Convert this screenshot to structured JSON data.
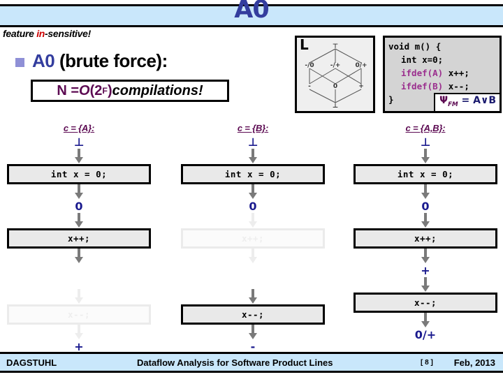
{
  "header": {
    "title": "A0",
    "subtitle_prefix": "feature ",
    "subtitle_highlight": "in",
    "subtitle_suffix": "-sensitive!"
  },
  "bullet": {
    "icon": "square-bullet-icon",
    "label_blue": "A0",
    "label_black": " (brute force):"
  },
  "formula": {
    "lhs": "N = ",
    "big_o": "O",
    "paren_open": "(2",
    "exponent": "F",
    "paren_close": ")",
    "rhs": " compilations!"
  },
  "lattice": {
    "panel_label": "L",
    "nodes": {
      "top": "⊤",
      "bottom": "⊥",
      "left_upper": "-/0",
      "mid_upper": "-/+",
      "right_upper": "0/+",
      "left_lower": "-",
      "mid_lower": "0",
      "right_lower": "+"
    }
  },
  "code": {
    "lines": [
      {
        "indent": 0,
        "parts": [
          {
            "t": "void m() {",
            "k": false
          }
        ]
      },
      {
        "indent": 1,
        "parts": [
          {
            "t": "int x=0;",
            "k": false
          }
        ]
      },
      {
        "indent": 1,
        "parts": [
          {
            "t": "ifdef(A)",
            "k": true
          },
          {
            "t": " x++;",
            "k": false
          }
        ]
      },
      {
        "indent": 1,
        "parts": [
          {
            "t": "ifdef(B)",
            "k": true
          },
          {
            "t": " x--;",
            "k": false
          }
        ]
      },
      {
        "indent": 0,
        "parts": [
          {
            "t": "}",
            "k": false
          }
        ]
      }
    ],
    "fm_badge": {
      "psi": "Ψ",
      "subscript": "FM",
      "equals": " = ",
      "expr": "A∨B"
    }
  },
  "columns": [
    {
      "header": "c = {A}:",
      "steps": [
        {
          "kind": "value",
          "text": "⊥",
          "faded": false
        },
        {
          "kind": "arrow",
          "faded": false
        },
        {
          "kind": "box",
          "text": "int x = 0;",
          "faded": false
        },
        {
          "kind": "arrow",
          "faded": false
        },
        {
          "kind": "value",
          "text": "0",
          "faded": false
        },
        {
          "kind": "arrow",
          "faded": false
        },
        {
          "kind": "box",
          "text": "x++;",
          "faded": false
        },
        {
          "kind": "arrow",
          "faded": false
        },
        {
          "kind": "spacer"
        },
        {
          "kind": "arrow",
          "faded": true
        },
        {
          "kind": "box",
          "text": "x--;",
          "faded": true
        },
        {
          "kind": "arrow",
          "faded": true
        },
        {
          "kind": "value",
          "text": "+",
          "faded": false
        }
      ]
    },
    {
      "header": "c = {B}:",
      "steps": [
        {
          "kind": "value",
          "text": "⊥",
          "faded": false
        },
        {
          "kind": "arrow",
          "faded": false
        },
        {
          "kind": "box",
          "text": "int x = 0;",
          "faded": false
        },
        {
          "kind": "arrow",
          "faded": false
        },
        {
          "kind": "value",
          "text": "0",
          "faded": false
        },
        {
          "kind": "arrow",
          "faded": true
        },
        {
          "kind": "box",
          "text": "x++;",
          "faded": true
        },
        {
          "kind": "arrow",
          "faded": true
        },
        {
          "kind": "spacer"
        },
        {
          "kind": "arrow",
          "faded": false
        },
        {
          "kind": "box",
          "text": "x--;",
          "faded": false
        },
        {
          "kind": "arrow",
          "faded": false
        },
        {
          "kind": "value",
          "text": "-",
          "faded": false
        }
      ]
    },
    {
      "header": "c = {A,B}:",
      "steps": [
        {
          "kind": "value",
          "text": "⊥",
          "faded": false
        },
        {
          "kind": "arrow",
          "faded": false
        },
        {
          "kind": "box",
          "text": "int x = 0;",
          "faded": false
        },
        {
          "kind": "arrow",
          "faded": false
        },
        {
          "kind": "value",
          "text": "0",
          "faded": false
        },
        {
          "kind": "arrow",
          "faded": false
        },
        {
          "kind": "box",
          "text": "x++;",
          "faded": false
        },
        {
          "kind": "arrow",
          "faded": false
        },
        {
          "kind": "value",
          "text": "+",
          "faded": false
        },
        {
          "kind": "arrow",
          "faded": false
        },
        {
          "kind": "box",
          "text": "x--;",
          "faded": false
        },
        {
          "kind": "arrow",
          "faded": false
        },
        {
          "kind": "value",
          "text": "0/+",
          "faded": false
        }
      ]
    }
  ],
  "footer": {
    "left": "DAGSTUHL",
    "center": "Dataflow Analysis for Software Product Lines",
    "page": "[ 8 ]",
    "right": "Feb, 2013"
  },
  "colors": {
    "bar_blue": "#c9e7fb",
    "title_blue": "#333d9e",
    "accent_purple": "#5c0a52",
    "value_blue": "#1a1a8e",
    "red": "#cc0000",
    "code_bg": "#d4d4d4",
    "keyword_purple": "#9b2f8e"
  }
}
